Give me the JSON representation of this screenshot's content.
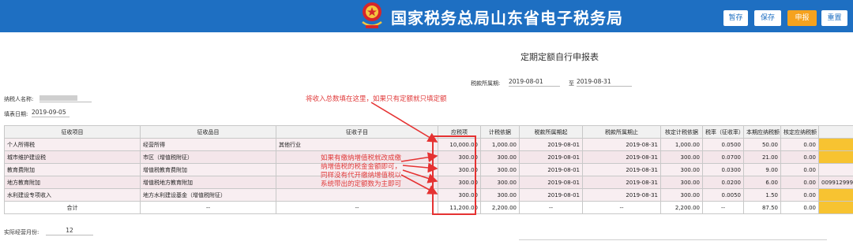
{
  "header": {
    "title": "国家税务总局山东省电子税务局",
    "buttons": {
      "save_draft": "暂存",
      "save": "保存",
      "declare": "申报",
      "reset": "重置"
    }
  },
  "form": {
    "title": "定期定额自行申报表",
    "period_label": "税款所属期:",
    "period_from": "2019-08-01",
    "period_to_label": "至",
    "period_to": "2019-08-31",
    "taxpayer_label": "纳税人名称:",
    "fill_date_label": "填表日期:",
    "fill_date": "2019-09-05",
    "months_label": "实际经营月份:",
    "months_value": "12"
  },
  "annotations": {
    "top": "将收入总数填在这里，如果只有定额就只填定额",
    "middle": "如果有缴纳增值税就改成缴纳增值税的税金金额即可，同样没有代开缴纳增值税以系统带出的定额数为主即可"
  },
  "table": {
    "headers": [
      "征收项目",
      "征收品目",
      "征收子目",
      "应税项",
      "计税依据",
      "税款所属期起",
      "税款所属期止",
      "核定计税依据",
      "税率（征收率）",
      "本期应纳税额",
      "核定应纳税额"
    ],
    "rows": [
      [
        "个人所得税",
        "经营所得",
        "其他行业",
        "10,000.00",
        "1,000.00",
        "2019-08-01",
        "2019-08-31",
        "1,000.00",
        "0.0500",
        "50.00",
        "0.00",
        ""
      ],
      [
        "城市维护建设税",
        "市区（增值税附征）",
        "",
        "300.00",
        "300.00",
        "2019-08-01",
        "2019-08-31",
        "300.00",
        "0.0700",
        "21.00",
        "0.00",
        ""
      ],
      [
        "教育费附加",
        "增值税教育费附加",
        "",
        "300.00",
        "300.00",
        "2019-08-01",
        "2019-08-31",
        "300.00",
        "0.0300",
        "9.00",
        "0.00",
        ""
      ],
      [
        "地方教育附加",
        "增值税地方教育附加",
        "",
        "300.00",
        "300.00",
        "2019-08-01",
        "2019-08-31",
        "300.00",
        "0.0200",
        "6.00",
        "0.00",
        "009912999"
      ],
      [
        "水利建设专项收入",
        "地方水利建设基金（增值税附征）",
        "",
        "300.00",
        "300.00",
        "2019-08-01",
        "2019-08-31",
        "300.00",
        "0.0050",
        "1.50",
        "0.00",
        ""
      ]
    ],
    "total": [
      "合计",
      "--",
      "--",
      "11,200.00",
      "2,200.00",
      "--",
      "--",
      "2,200.00",
      "--",
      "87.50",
      "0.00",
      ""
    ]
  },
  "colors": {
    "header_bg": "#1e6fc2",
    "accent_orange": "#f5a21e",
    "annotation_red": "#e03a3a",
    "highlight_yellow": "#f7c331"
  }
}
